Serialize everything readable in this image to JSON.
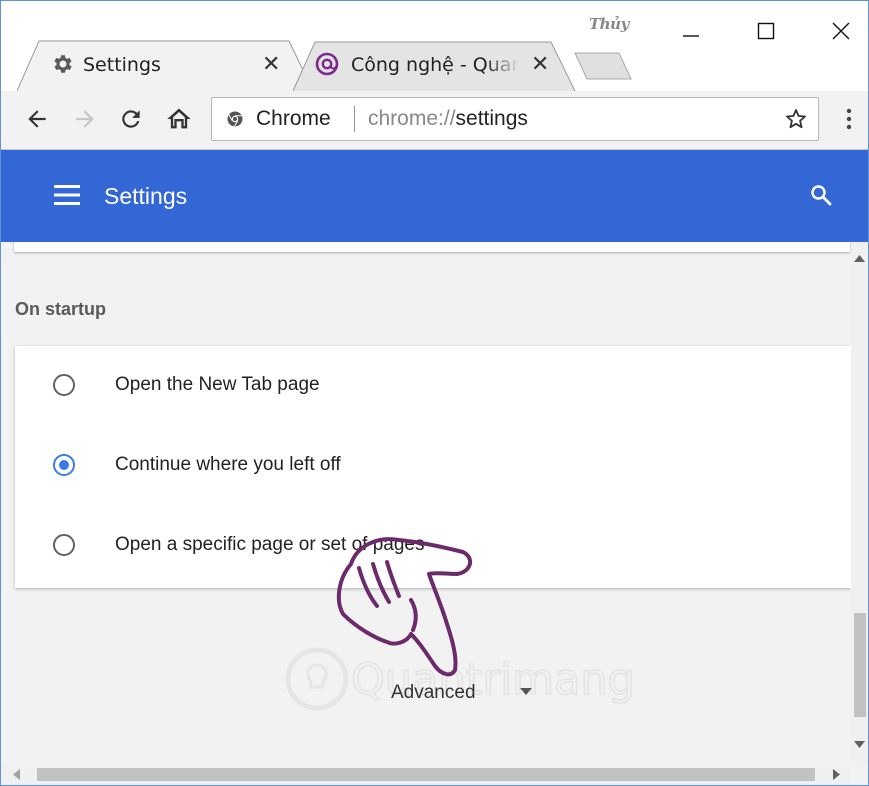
{
  "tabs": [
    {
      "title": "Settings",
      "icon": "gear-icon",
      "active": true
    },
    {
      "title": "Công nghệ - Quan",
      "icon": "site-favicon",
      "active": false
    }
  ],
  "profile_name": "Thủy",
  "toolbar": {
    "omnibox": {
      "chip": "Chrome",
      "url_scheme": "chrome://",
      "url_path": "settings"
    }
  },
  "header": {
    "title": "Settings"
  },
  "startup": {
    "section_title": "On startup",
    "options": [
      {
        "label": "Open the New Tab page",
        "selected": false
      },
      {
        "label": "Continue where you left off",
        "selected": true
      },
      {
        "label": "Open a specific page or set of pages",
        "selected": false
      }
    ]
  },
  "advanced_label": "Advanced",
  "watermark_text": "Quantrimang",
  "colors": {
    "header": "#3367d6",
    "accent": "#3b7be8",
    "pointer_hand": "#6b2a6b"
  }
}
